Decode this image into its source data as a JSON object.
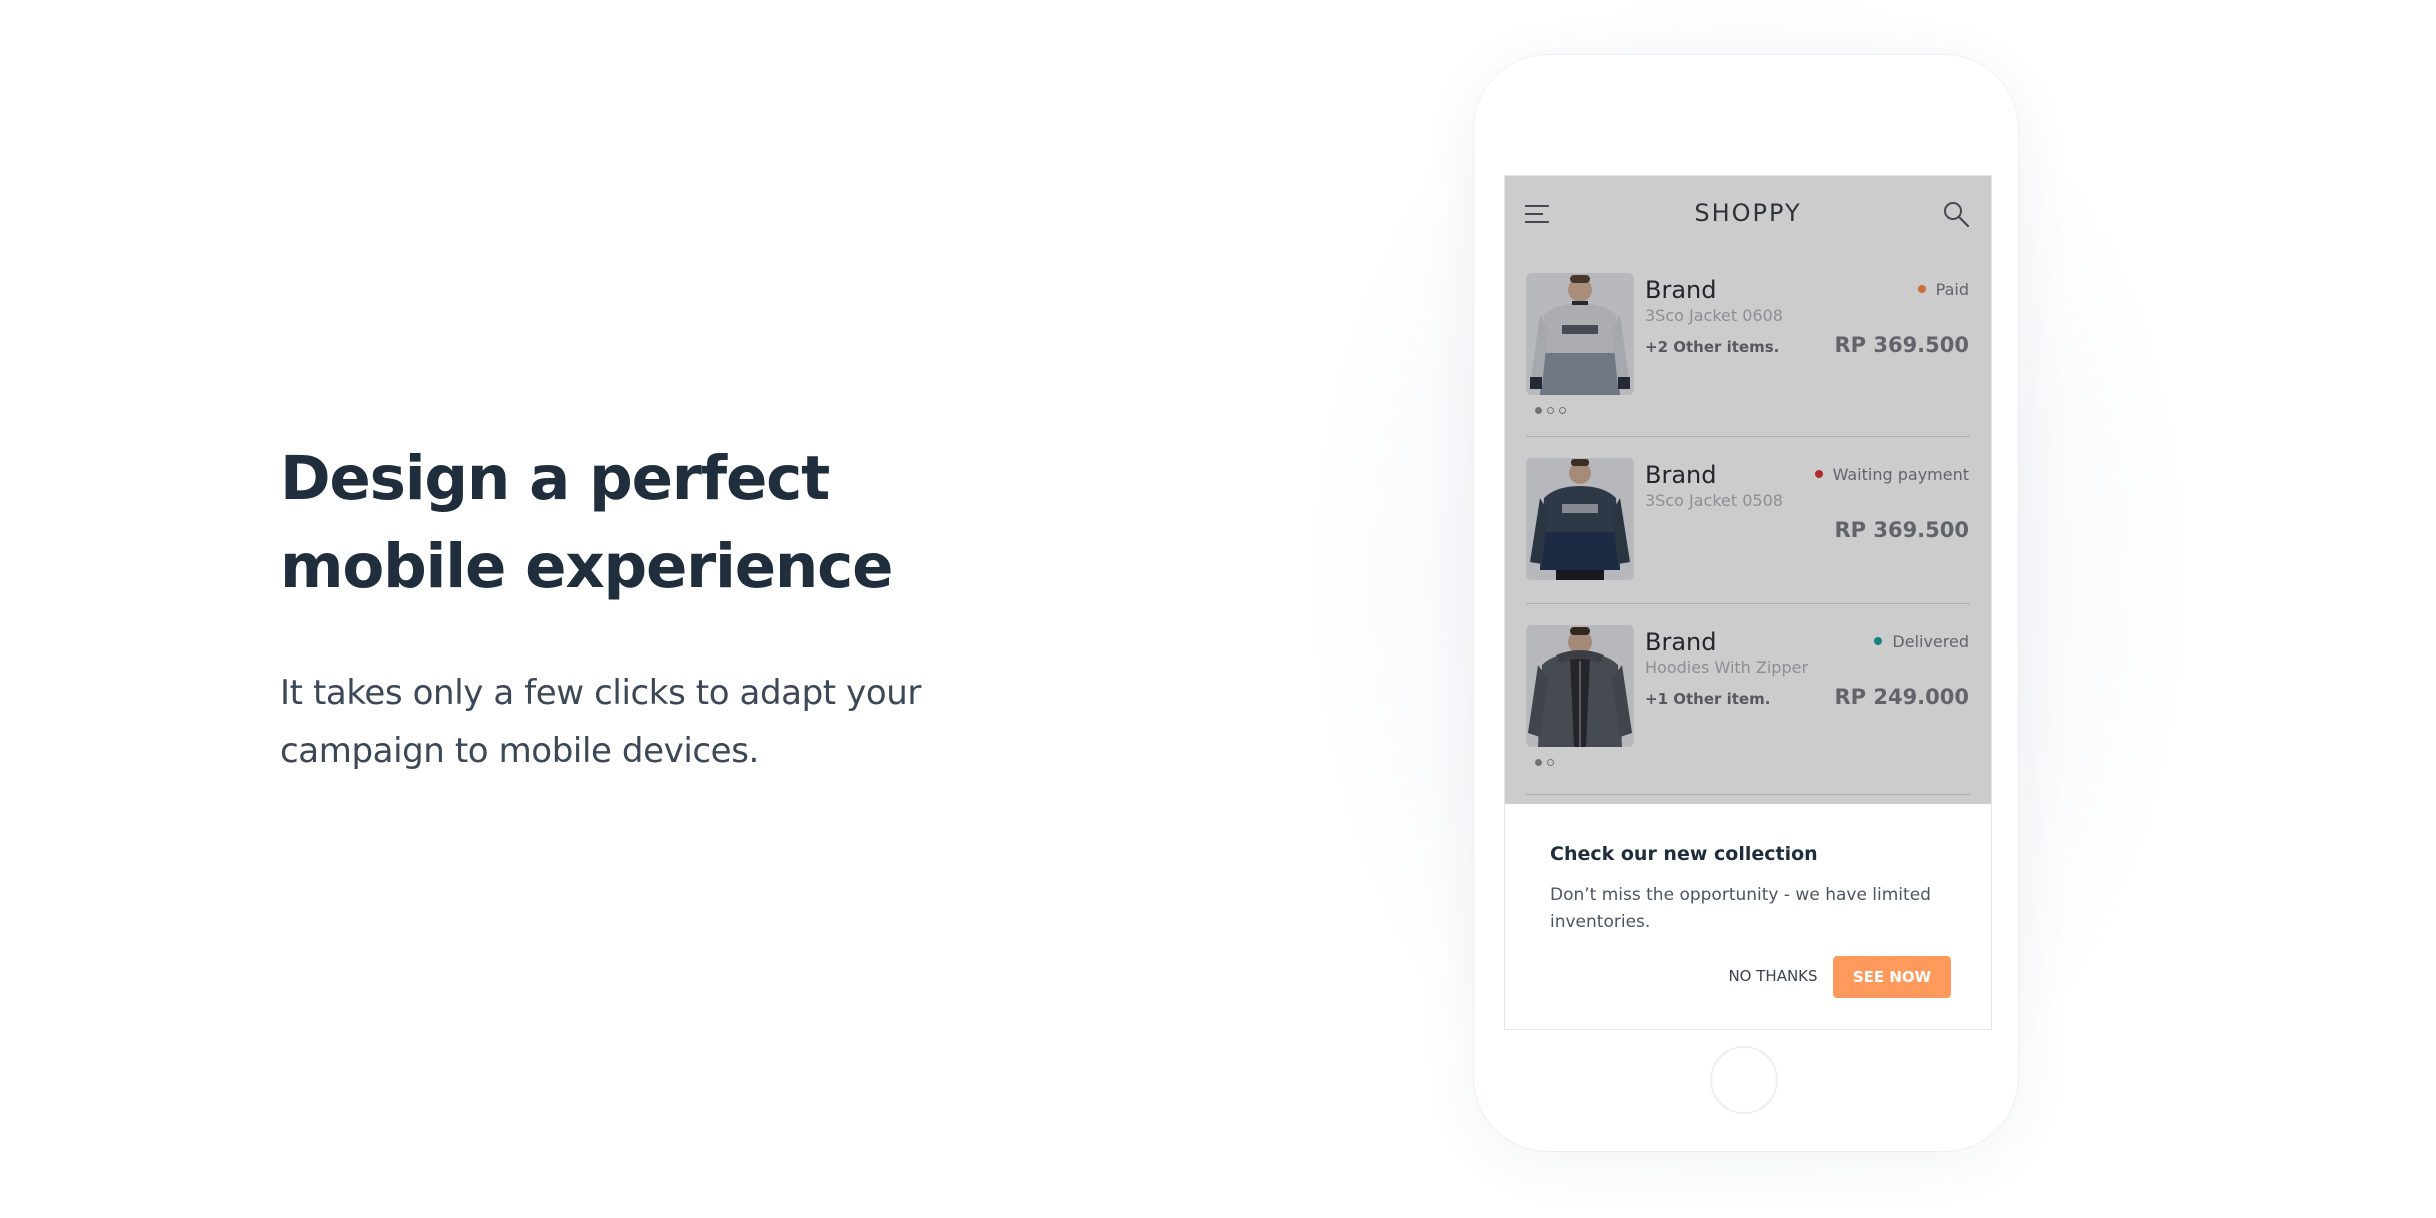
{
  "hero": {
    "headline": "Design a perfect mobile experience",
    "subtext": "It takes only a few clicks to adapt your campaign to mobile devices."
  },
  "app": {
    "title": "SHOPPY",
    "orders": [
      {
        "brand": "Brand",
        "item": "3Sco Jacket 0608",
        "other_items": "+2 Other items.",
        "status": "Paid",
        "status_color": "#ff8a4c",
        "price": "RP 369.500",
        "image_icon": "light-sweater-photo",
        "pager_dots": 3
      },
      {
        "brand": "Brand",
        "item": "3Sco Jacket 0508",
        "other_items": "",
        "status": "Waiting payment",
        "status_color": "#d93838",
        "price": "RP 369.500",
        "image_icon": "navy-sweater-photo",
        "pager_dots": 0
      },
      {
        "brand": "Brand",
        "item": "Hoodies With Zipper",
        "other_items": "+1 Other item.",
        "status": "Delivered",
        "status_color": "#1fa2a2",
        "price": "RP 249.000",
        "image_icon": "grey-hoodie-photo",
        "pager_dots": 2
      }
    ]
  },
  "sheet": {
    "title": "Check our new collection",
    "body": "Don’t miss the opportunity - we have limited inventories.",
    "no_thanks": "NO THANKS",
    "see_now": "SEE NOW",
    "accent": "#ff9a5c"
  }
}
